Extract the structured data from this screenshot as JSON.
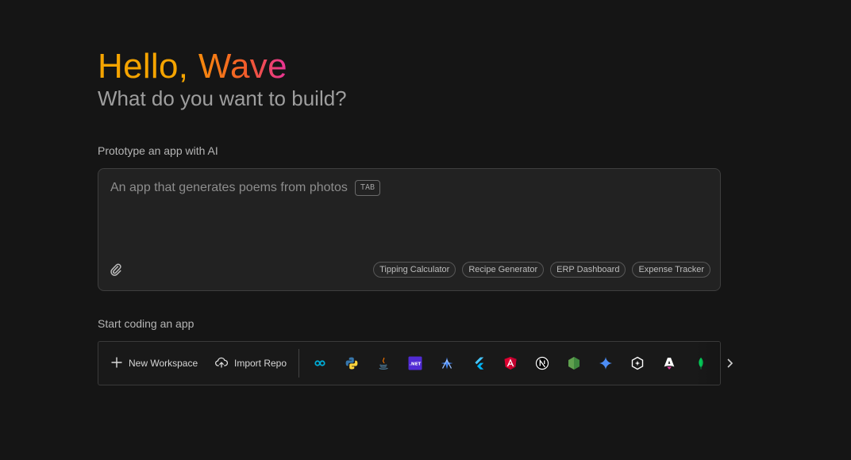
{
  "greeting": {
    "hello": "Hello,",
    "name": "Wave"
  },
  "subtitle": "What do you want to build?",
  "prototype": {
    "label": "Prototype an app with AI",
    "placeholder": "An app that generates poems from photos",
    "tab_hint": "TAB",
    "attach_icon": "paperclip-icon",
    "suggestions": [
      "Tipping Calculator",
      "Recipe Generator",
      "ERP Dashboard",
      "Expense Tracker"
    ]
  },
  "coding": {
    "label": "Start coding an app",
    "new_workspace": "New Workspace",
    "import_repo": "Import Repo",
    "templates": [
      {
        "name": "go-template-icon",
        "color": "#00acd7"
      },
      {
        "name": "python-template-icon",
        "color": "#3776ab"
      },
      {
        "name": "java-template-icon",
        "color": "#e76f00"
      },
      {
        "name": "dotnet-template-icon",
        "color": "#512bd4",
        "text": ".NET"
      },
      {
        "name": "genkit-template-icon",
        "color": "#4285f4"
      },
      {
        "name": "flutter-template-icon",
        "color": "#47c5fb"
      },
      {
        "name": "angular-template-icon",
        "color": "#e40035"
      },
      {
        "name": "nextjs-template-icon",
        "color": "#ffffff"
      },
      {
        "name": "nodejs-template-icon",
        "color": "#5fa04e"
      },
      {
        "name": "gemini-template-icon",
        "color": "#4c8df6"
      },
      {
        "name": "hex-template-icon",
        "color": "#ffffff"
      },
      {
        "name": "astro-template-icon",
        "color": "#ffffff"
      },
      {
        "name": "mongodb-template-icon",
        "color": "#00ed64"
      }
    ],
    "more_icon": "chevron-right-icon"
  }
}
